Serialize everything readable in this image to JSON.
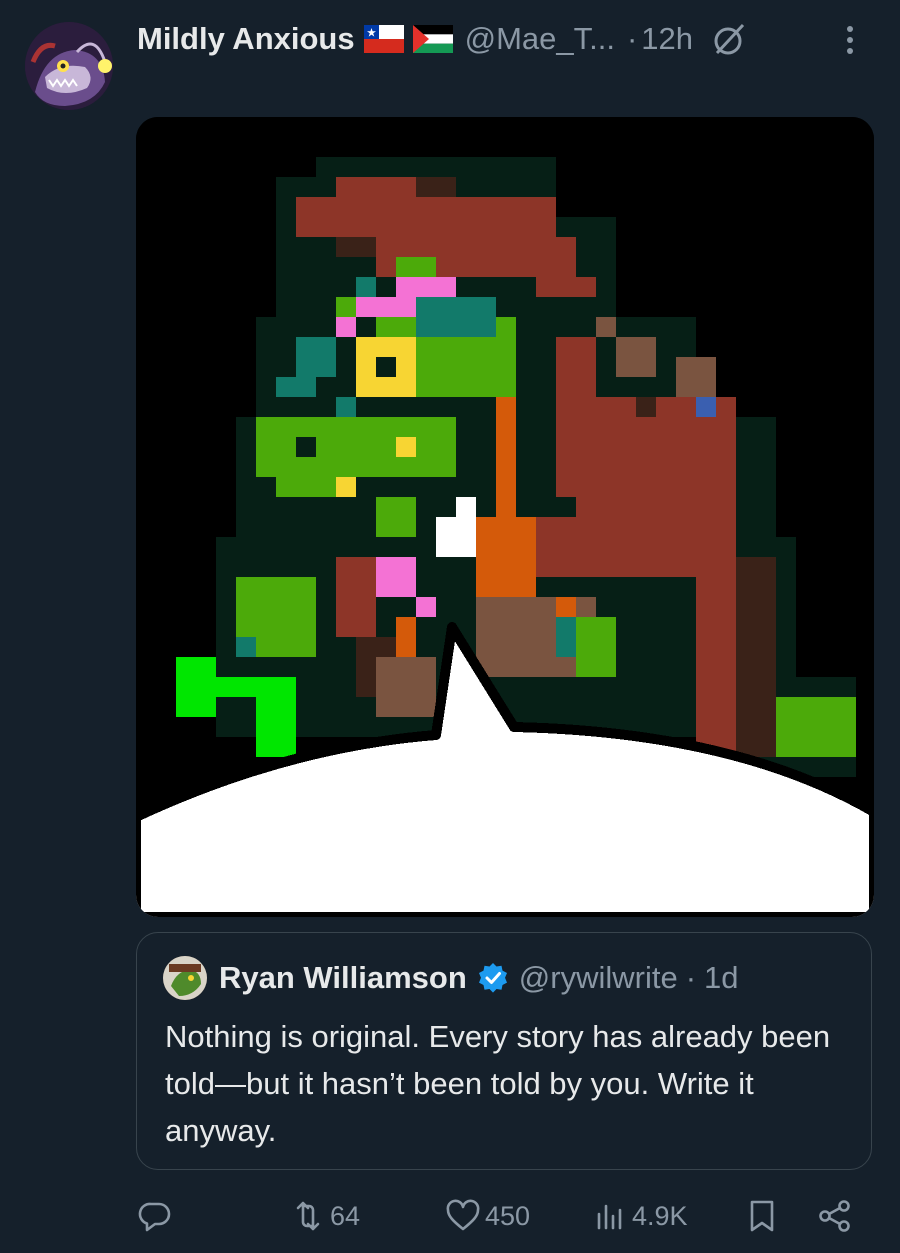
{
  "tweet": {
    "display_name": "Mildly Anxious",
    "flags": [
      "chile-flag",
      "palestine-flag"
    ],
    "handle": "@Mae_T...",
    "separator": "·",
    "time": "12h",
    "avatar_icon": "anglerfish-avatar",
    "media_icon": "pixel-art-dinosaur-speech-bubble"
  },
  "quote": {
    "name": "Ryan Williamson",
    "handle": "@rywilwrite",
    "separator": "·",
    "time": "1d",
    "text": "Nothing is original. Every story has already been told—but it hasn’t been told by you. Write it anyway."
  },
  "actions": {
    "reply_count": "",
    "retweet_count": "64",
    "like_count": "450",
    "view_count": "4.9K"
  },
  "colors": {
    "background": "#15202b",
    "text": "#e7e9ea",
    "muted": "#8b98a5",
    "border": "#38444d",
    "verified": "#1d9bf0"
  }
}
